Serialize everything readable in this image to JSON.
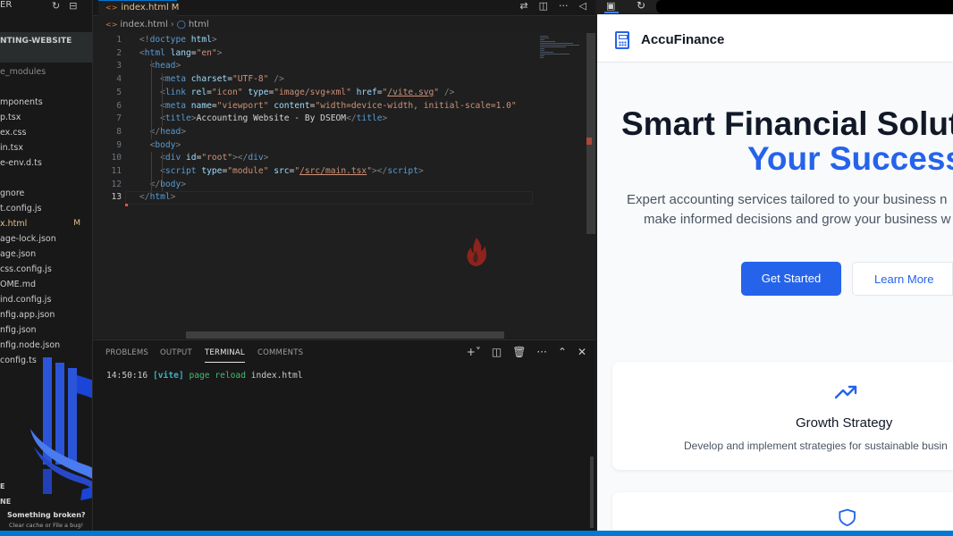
{
  "explorer": {
    "header": "ER",
    "project": "NTING-WEBSITE",
    "items": [
      {
        "label": "e_modules",
        "state": "dim"
      },
      {
        "label": "",
        "state": "gap"
      },
      {
        "label": "mponents",
        "state": "normal"
      },
      {
        "label": "p.tsx",
        "state": "normal"
      },
      {
        "label": "ex.css",
        "state": "normal"
      },
      {
        "label": "in.tsx",
        "state": "normal"
      },
      {
        "label": "e-env.d.ts",
        "state": "normal"
      },
      {
        "label": "",
        "state": "gap"
      },
      {
        "label": "gnore",
        "state": "normal"
      },
      {
        "label": "t.config.js",
        "state": "normal"
      },
      {
        "label": "x.html",
        "state": "active",
        "badge": "M"
      },
      {
        "label": "age-lock.json",
        "state": "normal"
      },
      {
        "label": "age.json",
        "state": "normal"
      },
      {
        "label": "css.config.js",
        "state": "normal"
      },
      {
        "label": "OME.md",
        "state": "normal"
      },
      {
        "label": "ind.config.js",
        "state": "normal"
      },
      {
        "label": "nfig.app.json",
        "state": "normal"
      },
      {
        "label": "nfig.json",
        "state": "normal"
      },
      {
        "label": "nfig.node.json",
        "state": "normal"
      },
      {
        "label": "config.ts",
        "state": "normal"
      }
    ],
    "outline_label": "E",
    "timeline_label": "NE",
    "broken_title": "Something broken?",
    "broken_sub": "Clear cache or File a bug!"
  },
  "editor": {
    "tab_label": "index.html",
    "tab_modified": "M",
    "breadcrumb_file": "index.html",
    "breadcrumb_node": "html",
    "lines": [
      [
        {
          "t": "br",
          "v": "<!"
        },
        {
          "t": "tag",
          "v": "doctype"
        },
        {
          "t": "txt",
          "v": " "
        },
        {
          "t": "attr",
          "v": "html"
        },
        {
          "t": "br",
          "v": ">"
        }
      ],
      [
        {
          "t": "br",
          "v": "<"
        },
        {
          "t": "tag",
          "v": "html"
        },
        {
          "t": "txt",
          "v": " "
        },
        {
          "t": "attr",
          "v": "lang"
        },
        {
          "t": "txt",
          "v": "="
        },
        {
          "t": "str",
          "v": "\"en\""
        },
        {
          "t": "br",
          "v": ">"
        }
      ],
      [
        {
          "t": "txt",
          "v": "  "
        },
        {
          "t": "br",
          "v": "<"
        },
        {
          "t": "tag",
          "v": "head"
        },
        {
          "t": "br",
          "v": ">"
        }
      ],
      [
        {
          "t": "txt",
          "v": "    "
        },
        {
          "t": "br",
          "v": "<"
        },
        {
          "t": "tag",
          "v": "meta"
        },
        {
          "t": "txt",
          "v": " "
        },
        {
          "t": "attr",
          "v": "charset"
        },
        {
          "t": "txt",
          "v": "="
        },
        {
          "t": "str",
          "v": "\"UTF-8\""
        },
        {
          "t": "txt",
          "v": " "
        },
        {
          "t": "br",
          "v": "/>"
        }
      ],
      [
        {
          "t": "txt",
          "v": "    "
        },
        {
          "t": "br",
          "v": "<"
        },
        {
          "t": "tag",
          "v": "link"
        },
        {
          "t": "txt",
          "v": " "
        },
        {
          "t": "attr",
          "v": "rel"
        },
        {
          "t": "txt",
          "v": "="
        },
        {
          "t": "str",
          "v": "\"icon\""
        },
        {
          "t": "txt",
          "v": " "
        },
        {
          "t": "attr",
          "v": "type"
        },
        {
          "t": "txt",
          "v": "="
        },
        {
          "t": "str",
          "v": "\"image/svg+xml\""
        },
        {
          "t": "txt",
          "v": " "
        },
        {
          "t": "attr",
          "v": "href"
        },
        {
          "t": "txt",
          "v": "="
        },
        {
          "t": "str",
          "v": "\""
        },
        {
          "t": "strlink",
          "v": "/vite.svg"
        },
        {
          "t": "str",
          "v": "\""
        },
        {
          "t": "txt",
          "v": " "
        },
        {
          "t": "br",
          "v": "/>"
        }
      ],
      [
        {
          "t": "txt",
          "v": "    "
        },
        {
          "t": "br",
          "v": "<"
        },
        {
          "t": "tag",
          "v": "meta"
        },
        {
          "t": "txt",
          "v": " "
        },
        {
          "t": "attr",
          "v": "name"
        },
        {
          "t": "txt",
          "v": "="
        },
        {
          "t": "str",
          "v": "\"viewport\""
        },
        {
          "t": "txt",
          "v": " "
        },
        {
          "t": "attr",
          "v": "content"
        },
        {
          "t": "txt",
          "v": "="
        },
        {
          "t": "str",
          "v": "\"width=device-width, initial-scale=1.0\""
        }
      ],
      [
        {
          "t": "txt",
          "v": "    "
        },
        {
          "t": "br",
          "v": "<"
        },
        {
          "t": "tag",
          "v": "title"
        },
        {
          "t": "br",
          "v": ">"
        },
        {
          "t": "txt",
          "v": "Accounting Website - By DSEOM"
        },
        {
          "t": "br",
          "v": "</"
        },
        {
          "t": "tag",
          "v": "title"
        },
        {
          "t": "br",
          "v": ">"
        }
      ],
      [
        {
          "t": "txt",
          "v": "  "
        },
        {
          "t": "br",
          "v": "</"
        },
        {
          "t": "tag",
          "v": "head"
        },
        {
          "t": "br",
          "v": ">"
        }
      ],
      [
        {
          "t": "txt",
          "v": "  "
        },
        {
          "t": "br",
          "v": "<"
        },
        {
          "t": "tag",
          "v": "body"
        },
        {
          "t": "br",
          "v": ">"
        }
      ],
      [
        {
          "t": "txt",
          "v": "    "
        },
        {
          "t": "br",
          "v": "<"
        },
        {
          "t": "tag",
          "v": "div"
        },
        {
          "t": "txt",
          "v": " "
        },
        {
          "t": "attr",
          "v": "id"
        },
        {
          "t": "txt",
          "v": "="
        },
        {
          "t": "str",
          "v": "\"root\""
        },
        {
          "t": "br",
          "v": "></"
        },
        {
          "t": "tag",
          "v": "div"
        },
        {
          "t": "br",
          "v": ">"
        }
      ],
      [
        {
          "t": "txt",
          "v": "    "
        },
        {
          "t": "br",
          "v": "<"
        },
        {
          "t": "tag",
          "v": "script"
        },
        {
          "t": "txt",
          "v": " "
        },
        {
          "t": "attr",
          "v": "type"
        },
        {
          "t": "txt",
          "v": "="
        },
        {
          "t": "str",
          "v": "\"module\""
        },
        {
          "t": "txt",
          "v": " "
        },
        {
          "t": "attr",
          "v": "src"
        },
        {
          "t": "txt",
          "v": "="
        },
        {
          "t": "str",
          "v": "\""
        },
        {
          "t": "strlink",
          "v": "/src/main.tsx"
        },
        {
          "t": "str",
          "v": "\""
        },
        {
          "t": "br",
          "v": "></"
        },
        {
          "t": "tag",
          "v": "script"
        },
        {
          "t": "br",
          "v": ">"
        }
      ],
      [
        {
          "t": "txt",
          "v": "  "
        },
        {
          "t": "br",
          "v": "</"
        },
        {
          "t": "tag",
          "v": "body"
        },
        {
          "t": "br",
          "v": ">"
        }
      ],
      [
        {
          "t": "br",
          "v": "</"
        },
        {
          "t": "tag",
          "v": "html"
        },
        {
          "t": "br",
          "v": ">"
        }
      ]
    ],
    "current_line": 13
  },
  "panel": {
    "tabs": [
      "PROBLEMS",
      "OUTPUT",
      "TERMINAL",
      "COMMENTS"
    ],
    "active_tab": "TERMINAL",
    "terminal": {
      "time": "14:50:16",
      "tag": "[vite]",
      "message": "page reload",
      "file": "index.html"
    }
  },
  "site": {
    "brand": "AccuFinance",
    "hero_line1": "Smart Financial Solut",
    "hero_line2": "Your Success",
    "sub_line1": "Expert accounting services tailored to your business n",
    "sub_line2": "make informed decisions and grow your business w",
    "primary_cta": "Get Started",
    "secondary_cta": "Learn More",
    "card1_title": "Growth Strategy",
    "card1_desc": "Develop and implement strategies for sustainable busin"
  },
  "colors": {
    "accent": "#2563eb",
    "vscode_blue": "#0078d4",
    "modified": "#e2c08d"
  },
  "icons": {
    "tab_file": "html-file-icon",
    "growth": "trending-up-icon",
    "card2": "shield-icon",
    "brand": "calculator-icon"
  }
}
